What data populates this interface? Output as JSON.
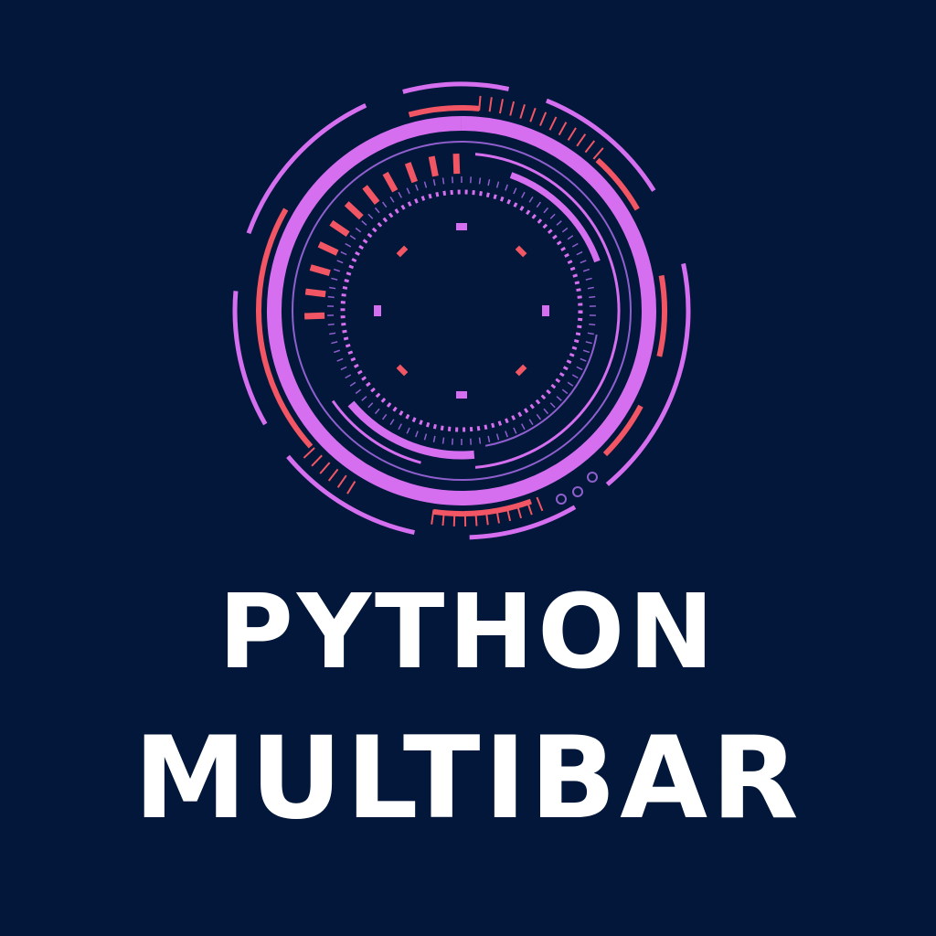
{
  "logo": {
    "name": "circular-hud-gauge-logo",
    "colors": {
      "background": "#02173a",
      "primary": "#d56ff0",
      "accent": "#f25563",
      "thin": "#8f5fce"
    }
  },
  "title": {
    "line1": "PYTHON",
    "line2": "MULTIBAR",
    "color": "#ffffff"
  }
}
